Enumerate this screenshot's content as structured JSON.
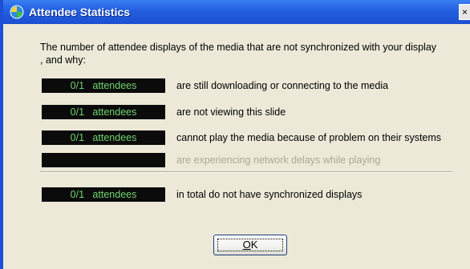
{
  "window": {
    "title": "Attendee Statistics",
    "close_glyph": "×",
    "icon": "media-globe-icon"
  },
  "dialog": {
    "intro_text": "The number of attendee displays of the media that are not synchronized with your display , and why:",
    "rows": [
      {
        "counter": "0/1   attendees",
        "description": "are still downloading or connecting to the media",
        "enabled": true
      },
      {
        "counter": "0/1   attendees",
        "description": "are not viewing this slide",
        "enabled": true
      },
      {
        "counter": "0/1   attendees",
        "description": "cannot play the media because of problem on their systems",
        "enabled": true
      },
      {
        "counter": "",
        "description": "are experiencing network delays while playing",
        "enabled": false
      }
    ],
    "total": {
      "counter": "0/1   attendees",
      "description": "in total do not have synchronized displays"
    },
    "ok_label_accel": "O",
    "ok_label_rest": "K"
  },
  "colors": {
    "titlebar": "#2461e0",
    "dialog_bg": "#ece9d8",
    "counter_bg": "#0b0b0b",
    "counter_text": "#6fd46f",
    "disabled_text": "#aca899"
  }
}
